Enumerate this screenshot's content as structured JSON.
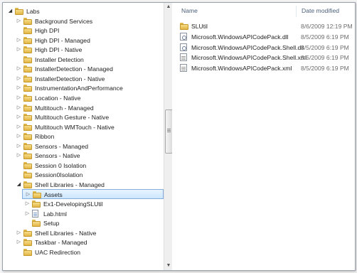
{
  "tree": {
    "items": [
      {
        "label": "Labs",
        "depth": 0,
        "arrow": "open"
      },
      {
        "label": "Background Services",
        "depth": 1,
        "arrow": "closed"
      },
      {
        "label": "High DPI",
        "depth": 1,
        "arrow": "none"
      },
      {
        "label": "High DPI - Managed",
        "depth": 1,
        "arrow": "closed"
      },
      {
        "label": "High DPI - Native",
        "depth": 1,
        "arrow": "closed"
      },
      {
        "label": "Installer Detection",
        "depth": 1,
        "arrow": "none"
      },
      {
        "label": "InstallerDetection - Managed",
        "depth": 1,
        "arrow": "closed"
      },
      {
        "label": "InstallerDetection - Native",
        "depth": 1,
        "arrow": "closed"
      },
      {
        "label": "InstrumentationAndPerformance",
        "depth": 1,
        "arrow": "closed"
      },
      {
        "label": "Location - Native",
        "depth": 1,
        "arrow": "closed"
      },
      {
        "label": "Multitouch - Managed",
        "depth": 1,
        "arrow": "closed"
      },
      {
        "label": "Multitouch Gesture - Native",
        "depth": 1,
        "arrow": "closed"
      },
      {
        "label": "Multitouch WMTouch - Native",
        "depth": 1,
        "arrow": "closed"
      },
      {
        "label": "Ribbon",
        "depth": 1,
        "arrow": "closed"
      },
      {
        "label": "Sensors - Managed",
        "depth": 1,
        "arrow": "closed"
      },
      {
        "label": "Sensors - Native",
        "depth": 1,
        "arrow": "closed"
      },
      {
        "label": "Session 0 Isolation",
        "depth": 1,
        "arrow": "none"
      },
      {
        "label": "Session0Isolation",
        "depth": 1,
        "arrow": "none"
      },
      {
        "label": "Shell Libraries - Managed",
        "depth": 1,
        "arrow": "open"
      },
      {
        "label": "Assets",
        "depth": 2,
        "arrow": "closed",
        "selected": true
      },
      {
        "label": "Ex1-DevelopingSLUtil",
        "depth": 2,
        "arrow": "closed"
      },
      {
        "label": "Lab.html",
        "depth": 2,
        "arrow": "closed",
        "icon": "file"
      },
      {
        "label": "Setup",
        "depth": 2,
        "arrow": "none"
      },
      {
        "label": "Shell Libraries - Native",
        "depth": 1,
        "arrow": "closed"
      },
      {
        "label": "Taskbar - Managed",
        "depth": 1,
        "arrow": "closed"
      },
      {
        "label": "UAC Redirection",
        "depth": 1,
        "arrow": "none"
      }
    ]
  },
  "columns": {
    "name": "Name",
    "date": "Date modified"
  },
  "files": [
    {
      "name": "SLUtil",
      "date": "8/6/2009 12:19 PM",
      "icon": "folder-icon"
    },
    {
      "name": "Microsoft.WindowsAPICodePack.dll",
      "date": "8/5/2009 6:19 PM",
      "icon": "dll-icon"
    },
    {
      "name": "Microsoft.WindowsAPICodePack.Shell.dll",
      "date": "8/5/2009 6:19 PM",
      "icon": "dll-icon"
    },
    {
      "name": "Microsoft.WindowsAPICodePack.Shell.xml",
      "date": "8/5/2009 6:19 PM",
      "icon": "xml-icon"
    },
    {
      "name": "Microsoft.WindowsAPICodePack.xml",
      "date": "8/5/2009 6:19 PM",
      "icon": "xml-icon"
    }
  ],
  "colors": {
    "selection": "#cce6ff",
    "folder": "#e8c35a",
    "header_text": "#4c607a"
  }
}
